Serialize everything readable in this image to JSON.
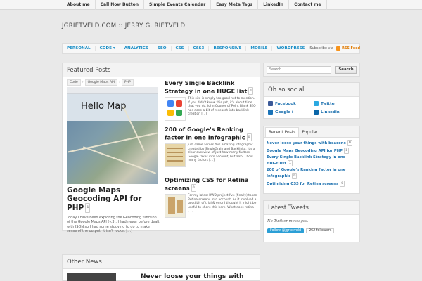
{
  "top_nav": [
    "About me",
    "Call Now Button",
    "Simple Events Calendar",
    "Easy Meta Tags",
    "LinkedIn",
    "Contact me"
  ],
  "site_title": "JGRIETVELD.COM :: JERRY G. RIETVELD",
  "categories": [
    "PERSONAL",
    "CODE ▾",
    "ANALYTICS",
    "SEO",
    "CSS",
    "CSS3",
    "RESPONSIVE",
    "MOBILE",
    "WORDPRESS"
  ],
  "subscribe": {
    "label": "Subscribe via",
    "feed": "RSS Feed"
  },
  "featured": {
    "heading": "Featured Posts",
    "main": {
      "breadcrumb": [
        "Code",
        "Google Maps API",
        "PHP"
      ],
      "hero_text": "Hello Map",
      "title": "Google Maps Geocoding API for PHP",
      "comments": "1",
      "excerpt": "Today I have been exploring the Geocoding function of the Google Maps API (v.3). I had never before dealt with JSON so I had some studying to do to make sense of the output. It isn't rocket […]"
    },
    "side": [
      {
        "title": "Every Single Backlink Strategy in one HUGE list",
        "comments": "1",
        "excerpt": "This site is simply too good not to mention. If you didn't know this yet, it's about time that you do. John Cooper of Point Blank SEO has done a bit of research into backlink creation […]"
      },
      {
        "title": "200 of Google's Ranking factor in one Infographic",
        "comments": "0",
        "excerpt": "Just came across this amazing infographic created by SingleGrain and Backlinko. It's a clear overview of just how many factors Google takes into account, but also… how many factors […]"
      },
      {
        "title": "Optimizing CSS for Retina screens",
        "comments": "0",
        "excerpt": "For my latest RWD project I've (finally) taken Retina screens into account. As it involved a good bit of trial & error I thought it might be useful to share this here. What does retina […]"
      }
    ]
  },
  "search": {
    "placeholder": "Search...",
    "button": "Search"
  },
  "social": {
    "heading": "Oh so social",
    "links": [
      "Facebook",
      "Twitter",
      "Google+",
      "Linkedin"
    ]
  },
  "recent": {
    "tabs": [
      "Recent Posts",
      "Popular"
    ],
    "items": [
      {
        "title": "Never loose your things with beacons",
        "comments": "0"
      },
      {
        "title": "Google Maps Geocoding API for PHP",
        "comments": "1"
      },
      {
        "title": "Every Single Backlink Strategy in one HUGE list",
        "comments": "1"
      },
      {
        "title": "200 of Google's Ranking factor in one Infographic",
        "comments": "0"
      },
      {
        "title": "Optimizing CSS for Retina screens",
        "comments": "0"
      }
    ]
  },
  "tweets": {
    "heading": "Latest Tweets",
    "empty": "No Twitter messages.",
    "follow": "Follow @jgrietveld",
    "followers": "262 followers"
  },
  "other_news": {
    "heading": "Other News",
    "first_title": "Never loose your things with"
  },
  "colors": {
    "link": "#1a8fc7",
    "rss": "#f7941d",
    "twitter_button": "#2b9fd6"
  }
}
